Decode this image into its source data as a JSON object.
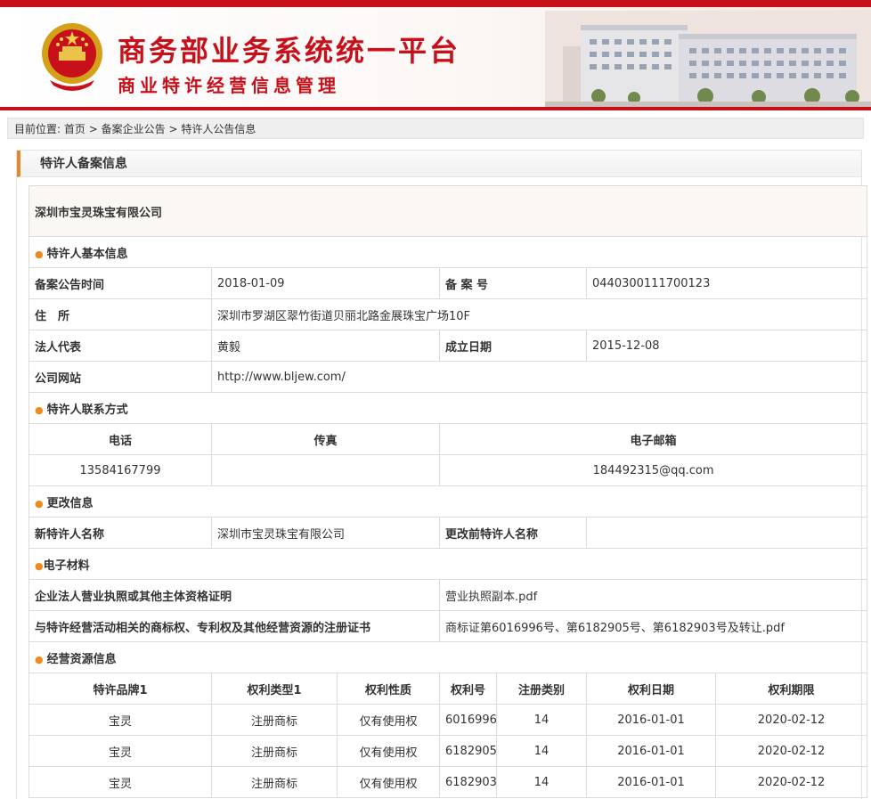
{
  "header": {
    "title": "商务部业务系统统一平台",
    "subtitle": "商业特许经营信息管理",
    "emblem_icon": "national-emblem-icon",
    "building_image": "ministry-building-image",
    "accent_color": "#c8101b"
  },
  "breadcrumb": {
    "prefix": "目前位置:",
    "items": [
      "首页",
      "备案企业公告",
      "特许人公告信息"
    ],
    "separator": ">"
  },
  "panel": {
    "title": "特许人备案信息"
  },
  "company_name": "深圳市宝灵珠宝有限公司",
  "basic_info": {
    "section": "特许人基本信息",
    "date_label": "备案公告时间",
    "date_value": "2018-01-09",
    "record_no_label": "备 案 号",
    "record_no_value": "0440300111700123",
    "address_label": "住　所",
    "address_value": "深圳市罗湖区翠竹街道贝丽北路金展珠宝广场10F",
    "legal_rep_label": "法人代表",
    "legal_rep_value": "黄毅",
    "founded_label": "成立日期",
    "founded_value": "2015-12-08",
    "website_label": "公司网站",
    "website_value": "http://www.bljew.com/"
  },
  "contact": {
    "section": "特许人联系方式",
    "phone_label": "电话",
    "fax_label": "传真",
    "email_label": "电子邮箱",
    "phone_value": "13584167799",
    "fax_value": "",
    "email_value": "184492315@qq.com"
  },
  "change_info": {
    "section": "更改信息",
    "new_name_label": "新特许人名称",
    "new_name_value": "深圳市宝灵珠宝有限公司",
    "old_name_label": "更改前特许人名称",
    "old_name_value": ""
  },
  "materials": {
    "section": "电子材料",
    "license_label": "企业法人营业执照或其他主体资格证明",
    "license_file": "营业执照副本.pdf",
    "trademark_label": "与特许经营活动相关的商标权、专利权及其他经营资源的注册证书",
    "trademark_file": "商标证第6016996号、第6182905号、第6182903号及转让.pdf"
  },
  "resources": {
    "section": "经营资源信息",
    "headers": [
      "特许品牌1",
      "权利类型1",
      "权利性质",
      "权利号",
      "注册类别",
      "权利日期",
      "权利期限"
    ],
    "rows": [
      [
        "宝灵",
        "注册商标",
        "仅有使用权",
        "6016996",
        "14",
        "2016-01-01",
        "2020-02-12"
      ],
      [
        "宝灵",
        "注册商标",
        "仅有使用权",
        "6182905",
        "14",
        "2016-01-01",
        "2020-02-12"
      ],
      [
        "宝灵",
        "注册商标",
        "仅有使用权",
        "6182903",
        "14",
        "2016-01-01",
        "2020-02-12"
      ]
    ]
  }
}
